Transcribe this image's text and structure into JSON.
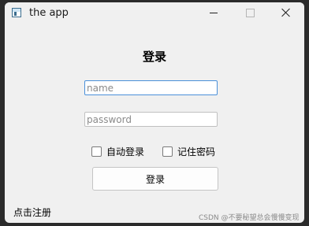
{
  "window": {
    "title": "the app",
    "icons": {
      "app": "app-window-icon",
      "minimize": "minimize-icon",
      "maximize": "maximize-icon",
      "close": "close-icon"
    }
  },
  "form": {
    "heading": "登录",
    "username_placeholder": "name",
    "username_value": "",
    "password_placeholder": "password",
    "password_value": "",
    "auto_login_label": "自动登录",
    "auto_login_checked": false,
    "remember_password_label": "记住密码",
    "remember_password_checked": false,
    "login_button_label": "登录",
    "register_link_label": "点击注册"
  },
  "overlay": {
    "watermark": "CSDN @不要秘望总会慢慢变现"
  },
  "colors": {
    "window_bg": "#f0f0f0",
    "focus_border": "#4a90d9",
    "desktop_bg": "#2b2b2b"
  }
}
